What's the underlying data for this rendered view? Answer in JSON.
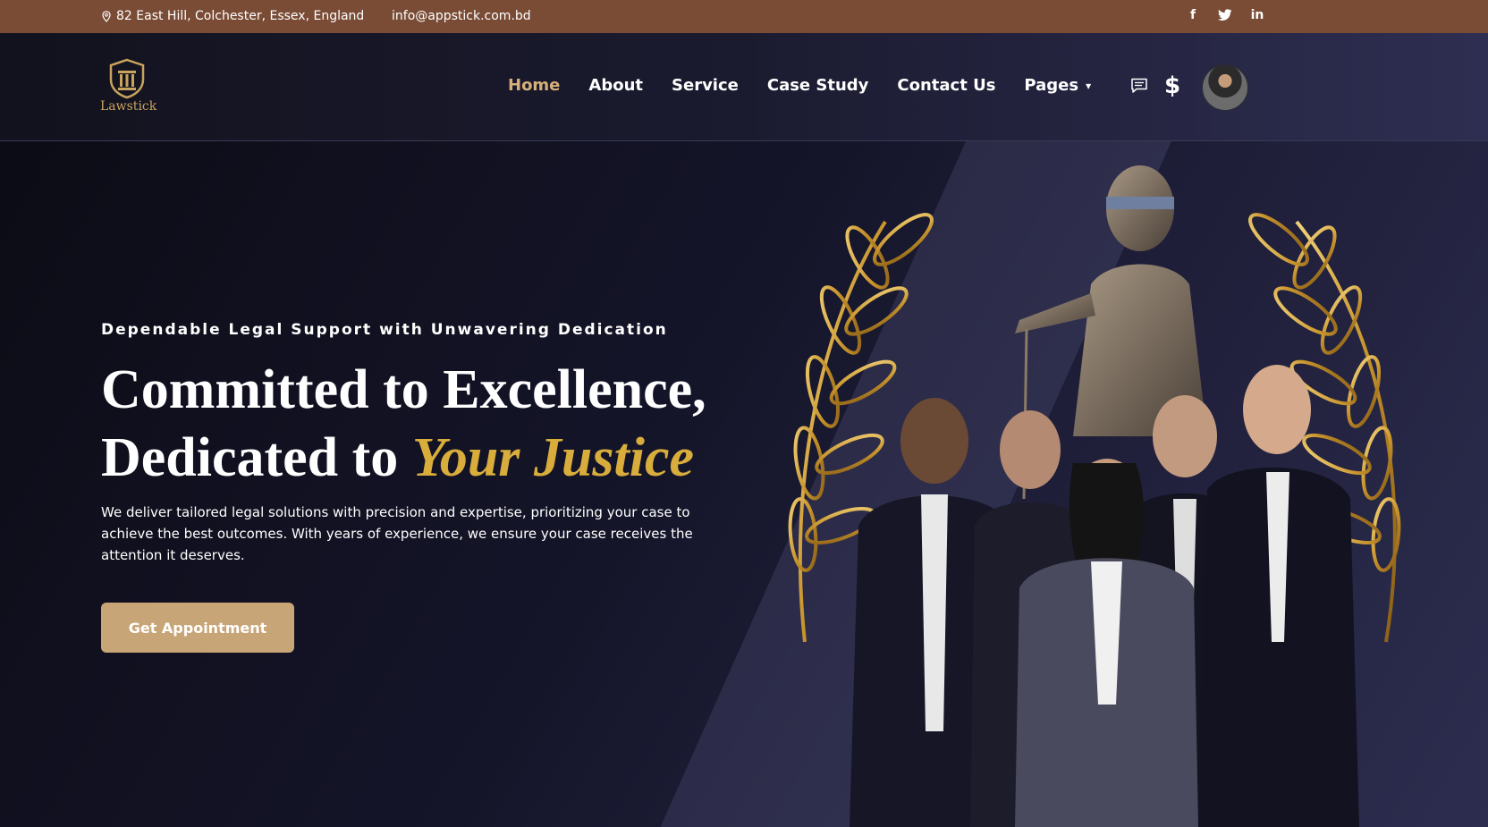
{
  "topbar": {
    "address": "82 East Hill, Colchester, Essex, England",
    "email": "info@appstick.com.bd",
    "social": [
      {
        "icon": "facebook-icon",
        "glyph": "f"
      },
      {
        "icon": "twitter-icon",
        "glyph": "🐦"
      },
      {
        "icon": "linkedin-icon",
        "glyph": "in"
      }
    ]
  },
  "header": {
    "logo_text": "Lawstick",
    "nav": [
      "Home",
      "About",
      "Service",
      "Case Study",
      "Contact Us",
      "Pages"
    ],
    "active_nav": "Home",
    "icons": [
      "chat-icon",
      "dollar-icon",
      "avatar"
    ]
  },
  "hero": {
    "tagline": "Dependable Legal Support with Unwavering Dedication",
    "title_line1": "Committed to Excellence,",
    "title_line2_prefix": "Dedicated to ",
    "title_line2_accent": "Your Justice",
    "description": "We deliver tailored legal solutions with precision and expertise, prioritizing your case to achieve the best outcomes. With years of experience, we ensure your case receives the attention it deserves.",
    "cta_label": "Get Appointment"
  },
  "colors": {
    "topbar": "#7a4c36",
    "accent_gold": "#d8ad3c",
    "cta": "#c8a577",
    "nav_active": "#d6b07a"
  }
}
